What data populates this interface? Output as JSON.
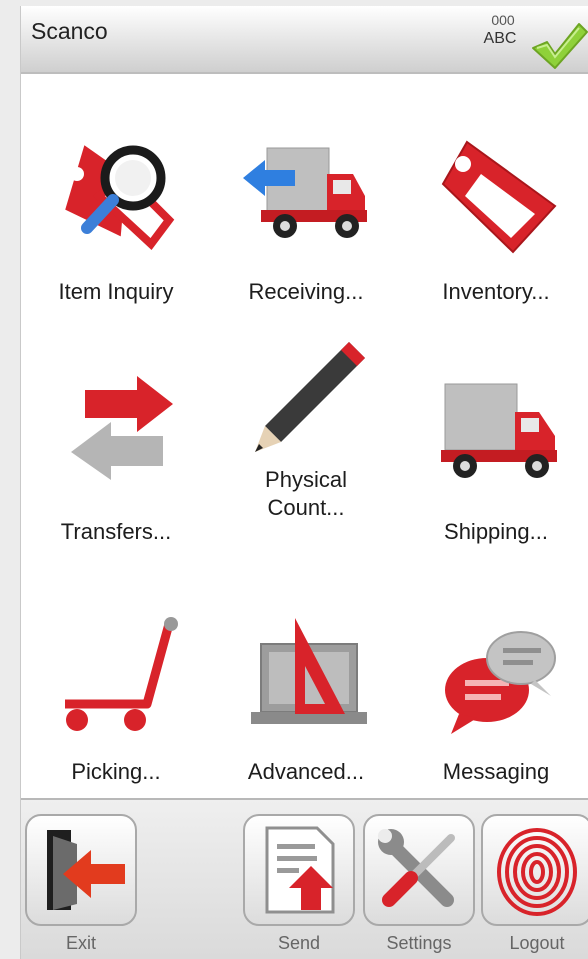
{
  "header": {
    "title": "Scanco",
    "code_number": "000",
    "code_text": "ABC"
  },
  "tiles": [
    {
      "label": "Item Inquiry"
    },
    {
      "label": "Receiving..."
    },
    {
      "label": "Inventory..."
    },
    {
      "label": "Transfers..."
    },
    {
      "label_line1": "Physical",
      "label_line2": "Count..."
    },
    {
      "label": "Shipping..."
    },
    {
      "label": "Picking..."
    },
    {
      "label": "Advanced..."
    },
    {
      "label": "Messaging"
    }
  ],
  "toolbar": {
    "exit": "Exit",
    "send": "Send",
    "settings": "Settings",
    "logout": "Logout"
  },
  "colors": {
    "accent_red": "#d8232a",
    "check_green": "#8fd13a",
    "header_bg": "#e0e0e0"
  }
}
